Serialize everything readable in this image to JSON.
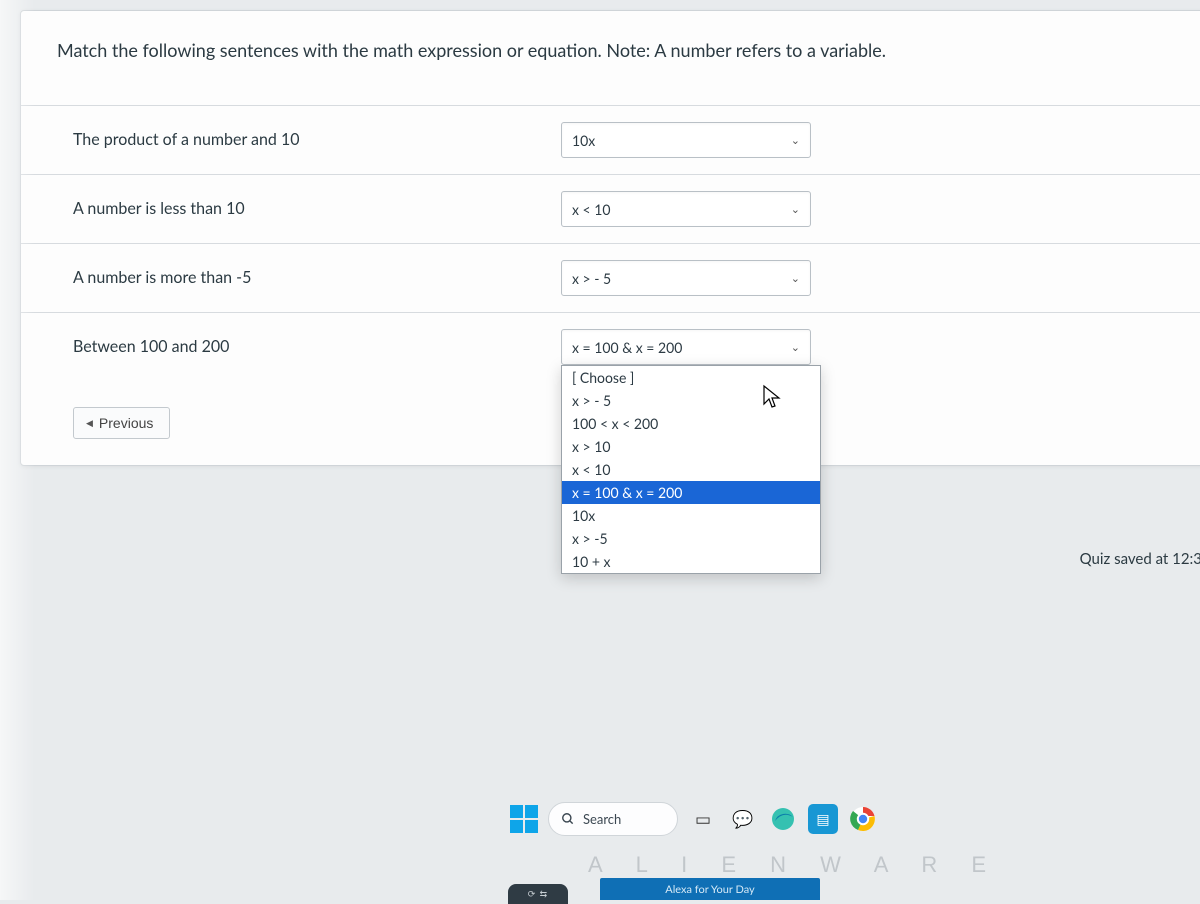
{
  "question": "Match the following sentences with the math expression or equation. Note: A number refers to a variable.",
  "rows": [
    {
      "label": "The product of a number and 10",
      "selected": "10x"
    },
    {
      "label": "A number is less than 10",
      "selected": "x < 10"
    },
    {
      "label": "A number is more than -5",
      "selected": "x > - 5"
    },
    {
      "label": "Between 100 and 200",
      "selected": "x = 100 & x = 200"
    }
  ],
  "dropdown_options": [
    "[ Choose ]",
    "x > - 5",
    "100 < x < 200",
    "x > 10",
    "x < 10",
    "x = 100 & x = 200",
    "10x",
    "x > -5",
    "10 + x"
  ],
  "dropdown_selected_index": 5,
  "prev_button": "Previous",
  "quiz_saved": "Quiz saved at 12:3",
  "taskbar": {
    "search_placeholder": "Search"
  },
  "alienware": "A L I E N W A R E",
  "alexa": "Alexa for Your Day"
}
